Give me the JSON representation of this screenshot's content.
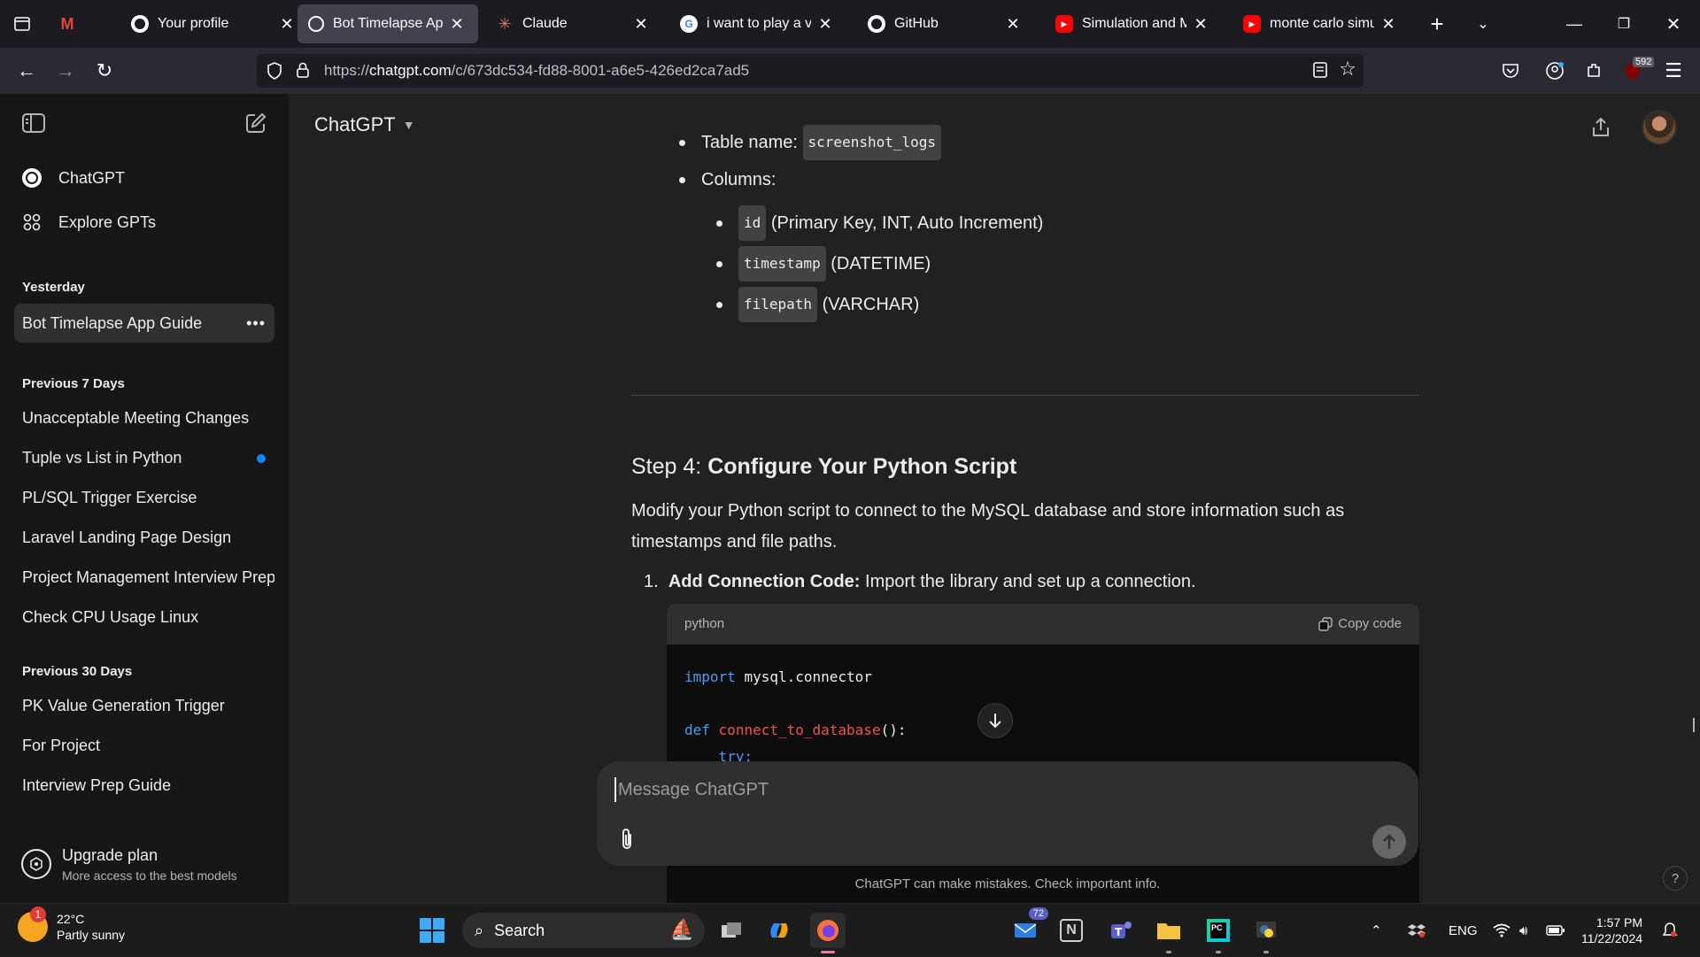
{
  "browser": {
    "tabs": [
      {
        "title": "",
        "fav": "M",
        "fav_color": "#ea4335",
        "active": false
      },
      {
        "title": "Your profile",
        "fav": "github",
        "active": false
      },
      {
        "title": "Bot Timelapse App (",
        "fav": "openai",
        "active": true
      },
      {
        "title": "Claude",
        "fav": "claude",
        "active": false
      },
      {
        "title": "i want to play a vide",
        "fav": "G",
        "active": false
      },
      {
        "title": "GitHub",
        "fav": "github",
        "active": false
      },
      {
        "title": "Simulation and Mod",
        "fav": "youtube",
        "active": false
      },
      {
        "title": "monte carlo simulati",
        "fav": "youtube",
        "active": false
      }
    ],
    "url_prefix": "https://",
    "url_host": "chatgpt.com",
    "url_path": "/c/673dc534-fd88-8001-a6e5-426ed2ca7ad5",
    "ext_badge": "592"
  },
  "sidebar": {
    "nav": [
      {
        "label": "ChatGPT",
        "icon": "openai-icon"
      },
      {
        "label": "Explore GPTs",
        "icon": "grid-icon"
      }
    ],
    "sections": [
      {
        "heading": "Yesterday",
        "items": [
          {
            "label": "Bot Timelapse App Guide",
            "active": true
          }
        ]
      },
      {
        "heading": "Previous 7 Days",
        "items": [
          {
            "label": "Unacceptable Meeting Changes"
          },
          {
            "label": "Tuple vs List in Python",
            "unread": true
          },
          {
            "label": "PL/SQL Trigger Exercise"
          },
          {
            "label": "Laravel Landing Page Design"
          },
          {
            "label": "Project Management Interview Prep"
          },
          {
            "label": "Check CPU Usage Linux"
          }
        ]
      },
      {
        "heading": "Previous 30 Days",
        "items": [
          {
            "label": "PK Value Generation Trigger"
          },
          {
            "label": "For Project"
          },
          {
            "label": "Interview Prep Guide"
          }
        ]
      }
    ],
    "upgrade_title": "Upgrade plan",
    "upgrade_sub": "More access to the best models"
  },
  "main": {
    "model": "ChatGPT",
    "table_name_label": "Table name:",
    "table_name": "screenshot_logs",
    "columns_label": "Columns:",
    "columns": [
      {
        "name": "id",
        "desc": "(Primary Key, INT, Auto Increment)"
      },
      {
        "name": "timestamp",
        "desc": "(DATETIME)"
      },
      {
        "name": "filepath",
        "desc": "(VARCHAR)"
      }
    ],
    "step_prefix": "Step 4:",
    "step_title": "Configure Your Python Script",
    "paragraph": "Modify your Python script to connect to the MySQL database and store information such as timestamps and file paths.",
    "list_num": "1.",
    "list_bold": "Add Connection Code:",
    "list_text": "Import the library and set up a connection.",
    "code_lang": "python",
    "copy_label": "Copy code",
    "code_import_kw": "import",
    "code_import_mod": "mysql.connector",
    "code_def_kw": "def",
    "code_fn": "connect_to_database",
    "code_fn_tail": "():",
    "code_try": "try:",
    "composer_placeholder": "Message ChatGPT",
    "disclaimer": "ChatGPT can make mistakes. Check important info.",
    "help": "?"
  },
  "taskbar": {
    "temp": "22°C",
    "weather": "Partly sunny",
    "weather_badge": "1",
    "search": "Search",
    "mail_badge": "72",
    "lang": "ENG",
    "time": "1:57 PM",
    "date": "11/22/2024"
  }
}
